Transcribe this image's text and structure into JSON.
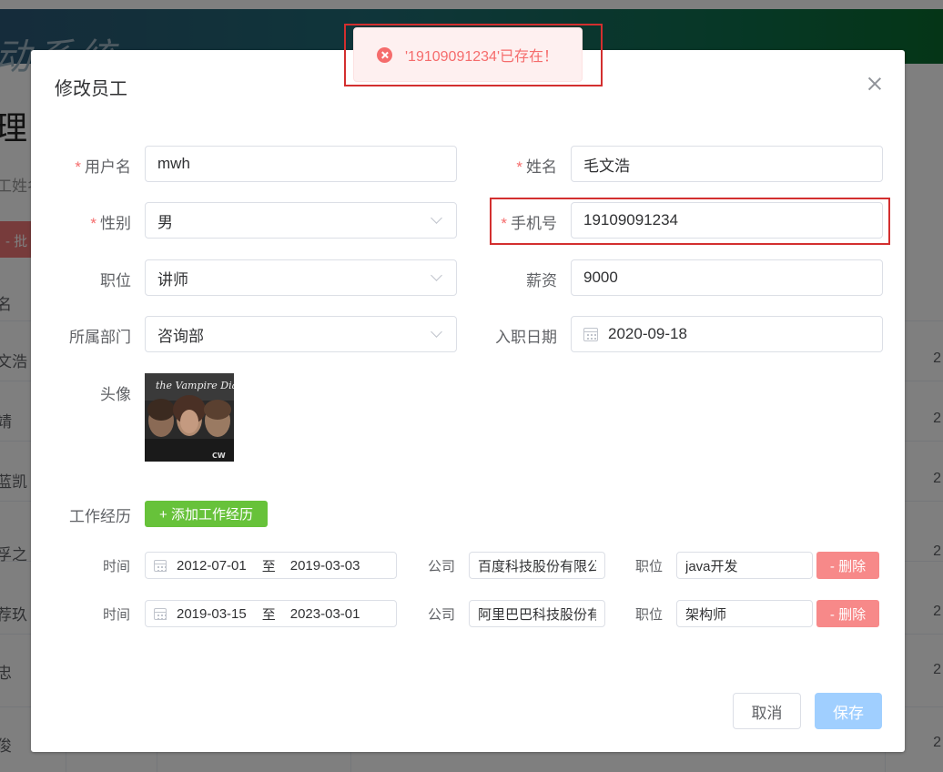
{
  "background": {
    "header_title": "动系统",
    "heading": "理",
    "search_label": "工姓名",
    "red_button": "- 批",
    "column_header": "名",
    "rows": [
      {
        "name": "文浩",
        "right": "2"
      },
      {
        "name": "靖",
        "right": "2"
      },
      {
        "name": "蓝凯",
        "right": "2"
      },
      {
        "name": "孚之",
        "right": "2"
      },
      {
        "name": "荐玖",
        "right": "2"
      },
      {
        "name": "忠",
        "right": "2"
      },
      {
        "name": "俊",
        "right": "2"
      }
    ]
  },
  "dialog": {
    "title": "修改员工",
    "form": {
      "username_label": "用户名",
      "username_value": "mwh",
      "name_label": "姓名",
      "name_value": "毛文浩",
      "gender_label": "性别",
      "gender_value": "男",
      "phone_label": "手机号",
      "phone_value": "19109091234",
      "position_label": "职位",
      "position_value": "讲师",
      "salary_label": "薪资",
      "salary_value": "9000",
      "dept_label": "所属部门",
      "dept_value": "咨询部",
      "entry_date_label": "入职日期",
      "entry_date_value": "2020-09-18",
      "avatar_label": "头像",
      "avatar_image_text": "the Vampire Diaries",
      "avatar_logo_text": "CW",
      "work_exp_label": "工作经历",
      "add_exp_button": "+ 添加工作经历",
      "required_mark": "*"
    },
    "experiences": [
      {
        "time_label": "时间",
        "start": "2012-07-01",
        "sep": "至",
        "end": "2019-03-03",
        "company_label": "公司",
        "company": "百度科技股份有限公司",
        "job_label": "职位",
        "job": "java开发",
        "delete_label": "- 删除"
      },
      {
        "time_label": "时间",
        "start": "2019-03-15",
        "sep": "至",
        "end": "2023-03-01",
        "company_label": "公司",
        "company": "阿里巴巴科技股份有限公司",
        "job_label": "职位",
        "job": "架构师",
        "delete_label": "- 删除"
      }
    ],
    "footer": {
      "cancel_label": "取消",
      "save_label": "保存"
    }
  },
  "toast": {
    "message": "'19109091234'已存在！",
    "type": "error",
    "color": "#f56c6c"
  },
  "colors": {
    "required": "#f56c6c",
    "success": "#67c23a",
    "danger": "#f78989",
    "primary_disabled": "#a0cfff",
    "highlight": "#d32f2f"
  }
}
